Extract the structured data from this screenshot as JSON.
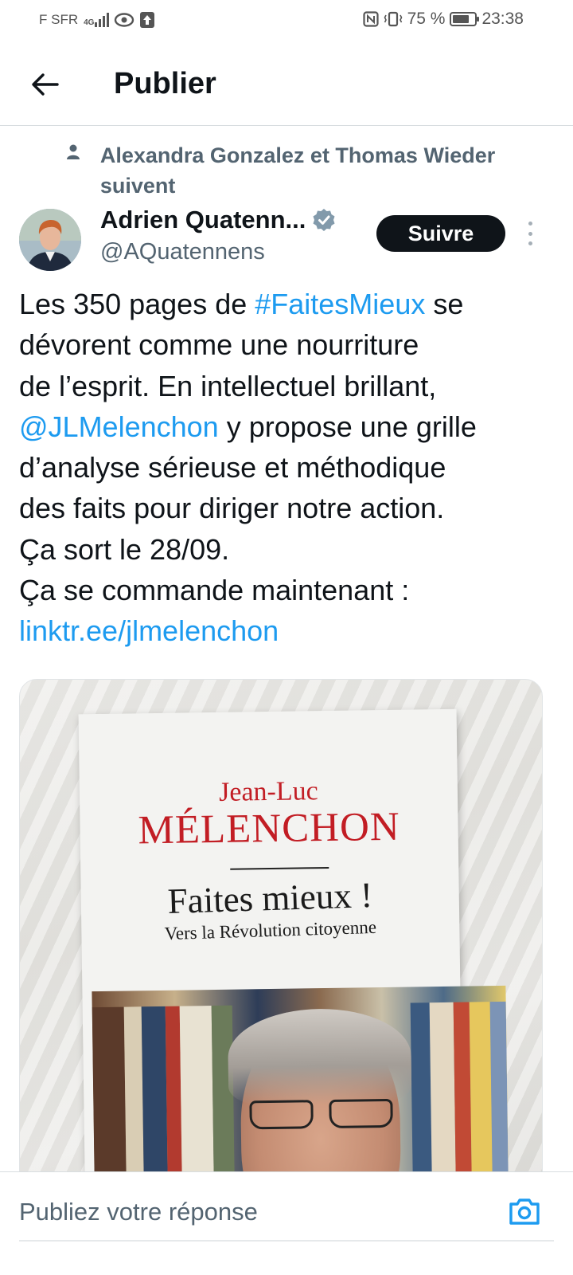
{
  "status_bar": {
    "carrier": "F SFR",
    "network": "4G",
    "battery_text": "75 %",
    "battery_level": 0.75,
    "time": "23:38",
    "icons": [
      "signal-icon",
      "eye-icon",
      "upload-icon",
      "nfc-icon",
      "vibrate-icon",
      "battery-icon"
    ]
  },
  "header": {
    "title": "Publier"
  },
  "tweet": {
    "social_context": "Alexandra Gonzalez et Thomas Wieder suivent",
    "author": {
      "name": "Adrien Quatenn...",
      "handle": "@AQuatennens",
      "verified": true
    },
    "follow_label": "Suivre",
    "text_lines": {
      "l1_a": "Les 350 pages de ",
      "l1_hashtag": "#FaitesMieux",
      "l1_b": " se",
      "l2": "dévorent comme une nourriture",
      "l3": "de l’esprit. En intellectuel brillant,",
      "l4_mention": "@JLMelenchon",
      "l4_b": " y propose une grille",
      "l5": "d’analyse sérieuse et méthodique",
      "l6": "des faits pour diriger notre action.",
      "l7": "Ça sort le 28/09.",
      "l8": "Ça se commande maintenant :",
      "l9_link": "linktr.ee/jlmelenchon"
    },
    "media": {
      "book_author_first": "Jean-Luc",
      "book_author_last": "MÉLENCHON",
      "book_title": "Faites mieux !",
      "book_subtitle": "Vers la Révolution citoyenne"
    }
  },
  "reply": {
    "placeholder": "Publiez votre réponse"
  },
  "colors": {
    "link": "#1d9bf0",
    "text": "#0f1419",
    "secondary": "#536471",
    "follow_bg": "#0f1419",
    "book_red": "#c21d24"
  }
}
